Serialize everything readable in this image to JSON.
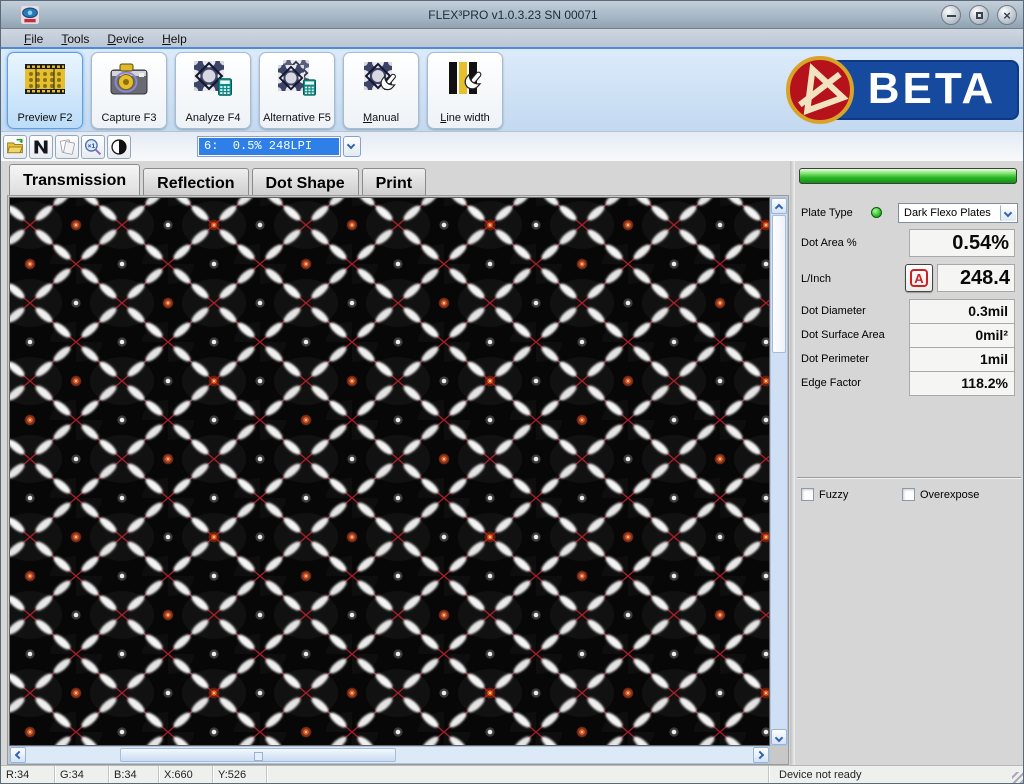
{
  "window": {
    "title": "FLEX³PRO v1.0.3.23 SN 00071"
  },
  "menu": {
    "items": [
      {
        "label": "File"
      },
      {
        "label": "Tools"
      },
      {
        "label": "Device"
      },
      {
        "label": "Help"
      }
    ]
  },
  "toolbar": {
    "buttons": [
      {
        "label": "Preview F2",
        "active": true
      },
      {
        "label": "Capture F3",
        "active": false
      },
      {
        "label": "Analyze F4",
        "active": false
      },
      {
        "label": "Alternative F5",
        "active": false
      },
      {
        "label": "Manual",
        "active": false
      },
      {
        "label": "Line width",
        "active": false
      }
    ]
  },
  "beta_logo": {
    "text": "BETA"
  },
  "quick_toolbar": {
    "combo_value": "6:  0.5% 248LPI"
  },
  "tabs": [
    {
      "label": "Transmission",
      "active": true
    },
    {
      "label": "Reflection",
      "active": false
    },
    {
      "label": "Dot Shape",
      "active": false
    },
    {
      "label": "Print",
      "active": false
    }
  ],
  "analysis_panel": {
    "plate_type": {
      "label": "Plate Type",
      "value": "Dark Flexo Plates"
    },
    "dot_area": {
      "label": "Dot Area %",
      "value": "0.54%"
    },
    "lpi": {
      "label": "L/Inch",
      "auto_button": "A",
      "value": "248.4"
    },
    "metrics": [
      {
        "label": "Dot Diameter",
        "value": "0.3mil"
      },
      {
        "label": "Dot Surface Area",
        "value": "0mil²"
      },
      {
        "label": "Dot Perimeter",
        "value": "1mil"
      },
      {
        "label": "Edge Factor",
        "value": "118.2%"
      }
    ],
    "options": [
      {
        "label": "Fuzzy",
        "checked": false
      },
      {
        "label": "Overexpose",
        "checked": false
      }
    ]
  },
  "status_bar": {
    "fields": [
      "R:34",
      "G:34",
      "B:34",
      "X:660",
      "Y:526"
    ],
    "message": "Device not ready"
  },
  "colors": {
    "selection_blue": "#2e80e8",
    "beta_blue": "#164a9e",
    "beta_red": "#b5121b",
    "screen_line_red": "#b01f2a",
    "led_green": "#2db829"
  }
}
